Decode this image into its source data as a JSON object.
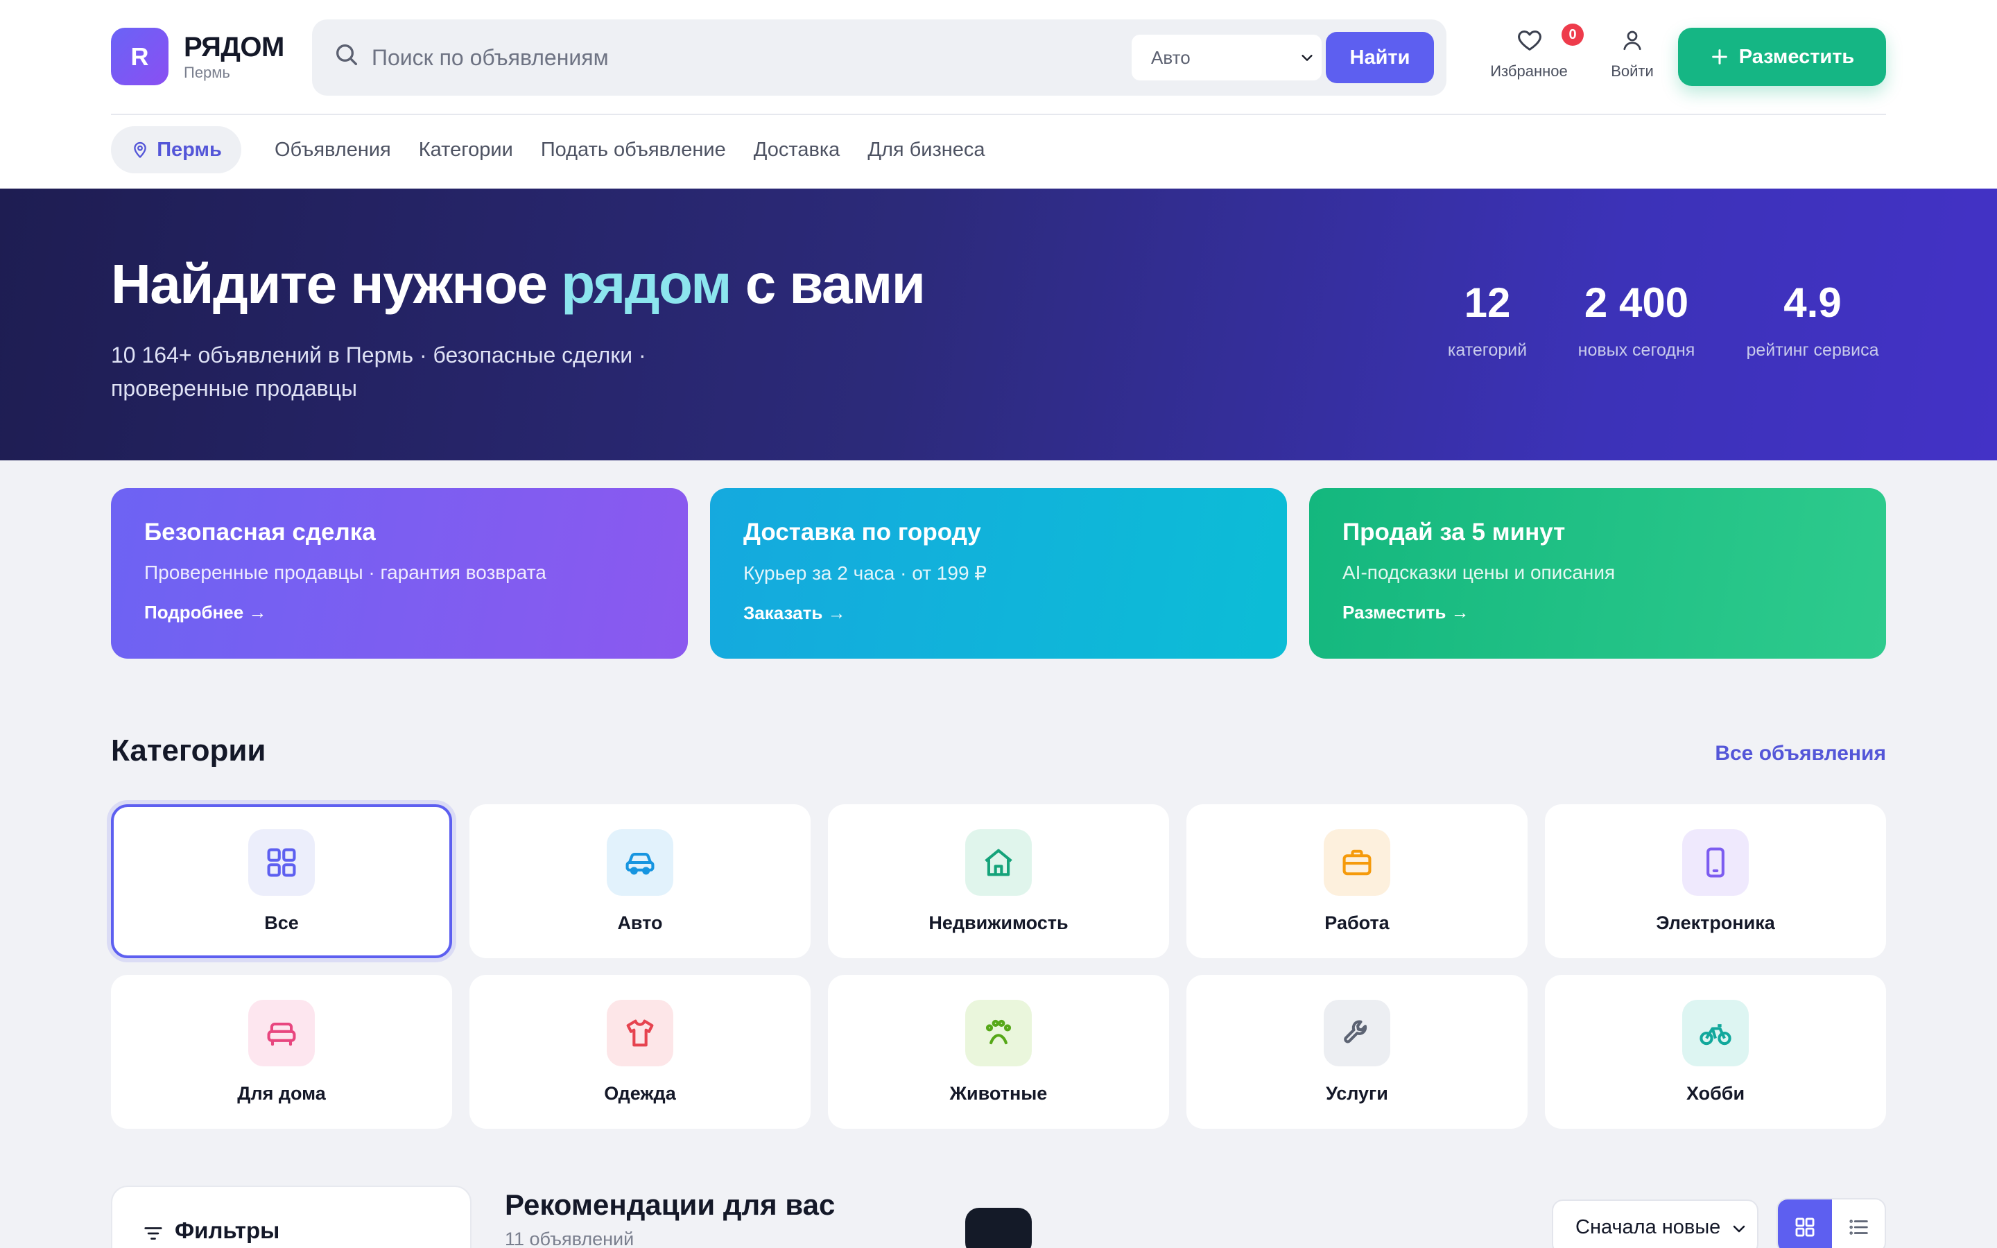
{
  "brand": {
    "logo_letter": "R",
    "name": "РЯДОМ",
    "city": "Пермь"
  },
  "search": {
    "placeholder": "Поиск по объявлениям",
    "category": "Авто",
    "button": "Найти"
  },
  "header": {
    "favorites_label": "Избранное",
    "favorites_count": "0",
    "login_label": "Войти",
    "post_button": "Разместить"
  },
  "nav": {
    "city": "Пермь",
    "items": [
      "Объявления",
      "Категории",
      "Подать объявление",
      "Доставка",
      "Для бизнеса"
    ]
  },
  "hero": {
    "title_part1": "Найдите нужное ",
    "title_accent": "рядом",
    "title_part2": " с вами",
    "subtitle": "10 164+ объявлений в Пермь · безопасные сделки · проверенные продавцы",
    "stats": [
      {
        "value": "12",
        "label": "категорий"
      },
      {
        "value": "2 400",
        "label": "новых сегодня"
      },
      {
        "value": "4.9",
        "label": "рейтинг сервиса"
      }
    ]
  },
  "promos": [
    {
      "title": "Безопасная сделка",
      "text": "Проверенные продавцы · гарантия возврата",
      "link": "Подробнее →"
    },
    {
      "title": "Доставка по городу",
      "text": "Курьер за 2 часа · от 199 ₽",
      "link": "Заказать →"
    },
    {
      "title": "Продай за 5 минут",
      "text": "AI-подсказки цены и описания",
      "link": "Разместить →"
    }
  ],
  "categories": {
    "title": "Категории",
    "all_link": "Все объявления",
    "items": [
      {
        "label": "Все",
        "icon": "grid-icon",
        "color": "#5d5ff0",
        "bg": "#eceefb"
      },
      {
        "label": "Авто",
        "icon": "car-icon",
        "color": "#1795e0",
        "bg": "#e2f2fc"
      },
      {
        "label": "Недвижимость",
        "icon": "house-icon",
        "color": "#15a37a",
        "bg": "#e0f5ec"
      },
      {
        "label": "Работа",
        "icon": "briefcase-icon",
        "color": "#f59a0b",
        "bg": "#fdf0dd"
      },
      {
        "label": "Электроника",
        "icon": "phone-icon",
        "color": "#7c5cf0",
        "bg": "#efe9fd"
      },
      {
        "label": "Для дома",
        "icon": "sofa-icon",
        "color": "#e8467f",
        "bg": "#fde6ef"
      },
      {
        "label": "Одежда",
        "icon": "shirt-icon",
        "color": "#e6434f",
        "bg": "#fde6e8"
      },
      {
        "label": "Животные",
        "icon": "paw-icon",
        "color": "#56a818",
        "bg": "#eaf6dc"
      },
      {
        "label": "Услуги",
        "icon": "wrench-icon",
        "color": "#5c6373",
        "bg": "#eceef2"
      },
      {
        "label": "Хобби",
        "icon": "bicycle-icon",
        "color": "#12a89c",
        "bg": "#ddf5f2"
      }
    ]
  },
  "listing": {
    "filters_label": "Фильтры",
    "title": "Рекомендации для вас",
    "count": "11 объявлений",
    "sort": "Сначала новые"
  }
}
